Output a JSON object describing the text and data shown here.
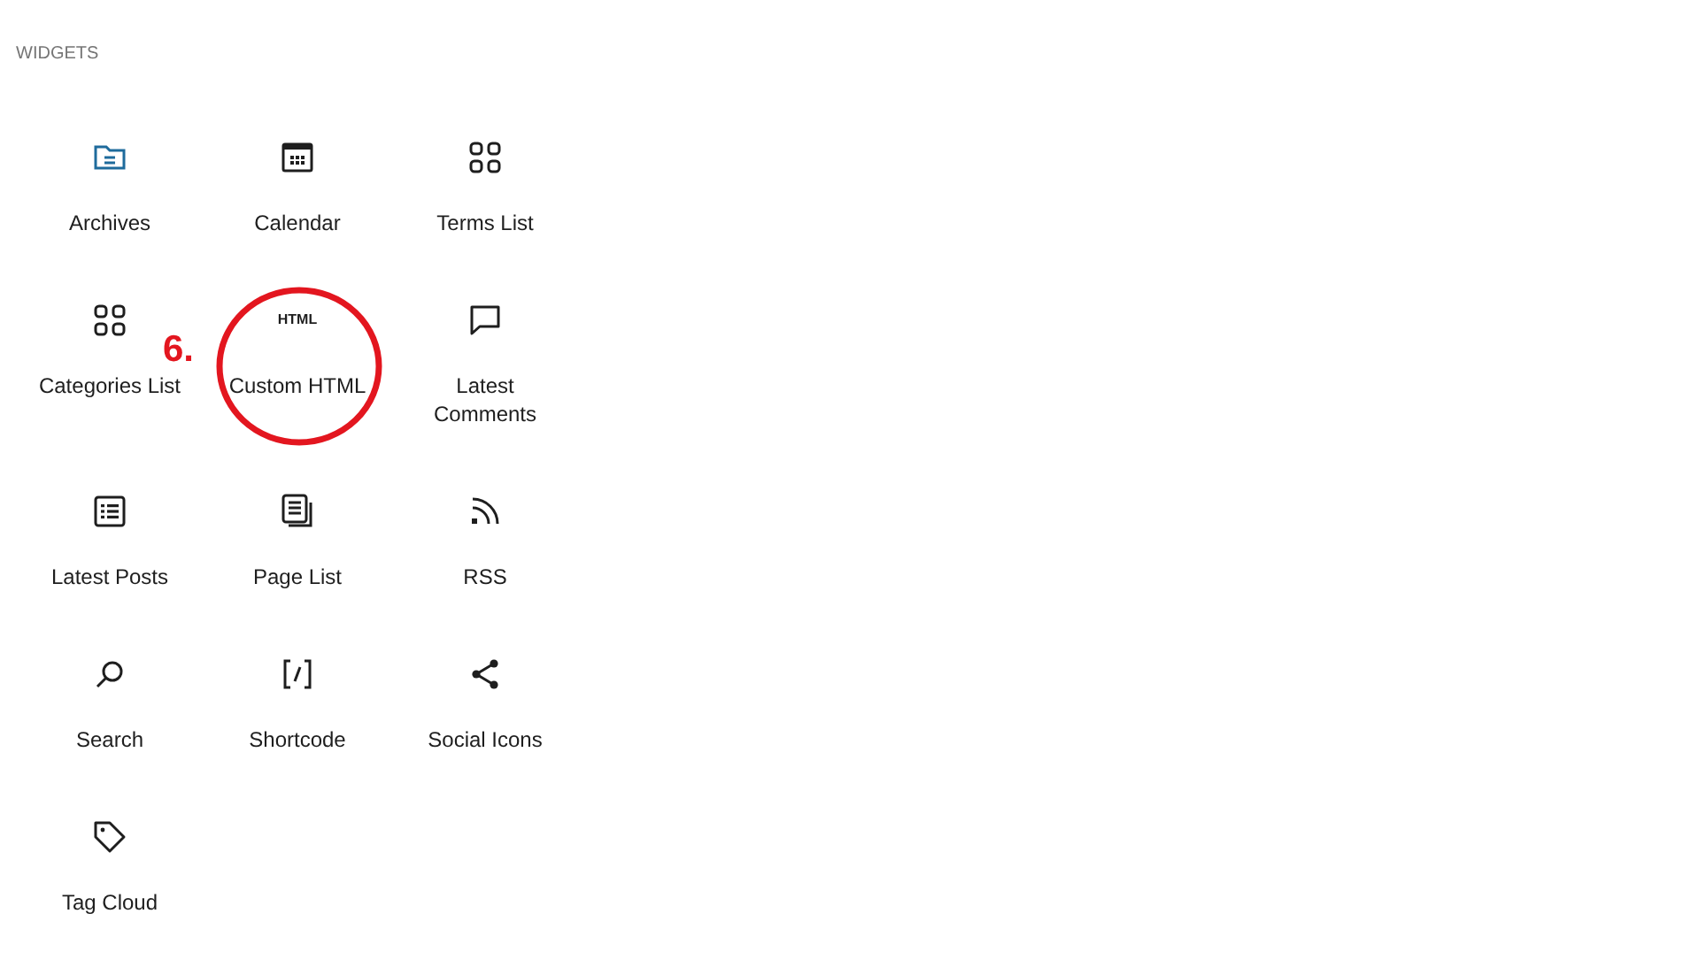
{
  "panel": {
    "heading": "WIDGETS"
  },
  "blocks": [
    {
      "label": "Archives",
      "kind": "archive",
      "highlighted": true,
      "circled": false
    },
    {
      "label": "Calendar",
      "kind": "calendar",
      "highlighted": false,
      "circled": false
    },
    {
      "label": "Terms List",
      "kind": "grid",
      "highlighted": false,
      "circled": false
    },
    {
      "label": "Categories List",
      "kind": "grid",
      "highlighted": false,
      "circled": false
    },
    {
      "label": "Custom HTML",
      "kind": "text",
      "icon_text": "HTML",
      "highlighted": false,
      "circled": true,
      "note": "6."
    },
    {
      "label": "Latest Comments",
      "kind": "comment",
      "highlighted": false,
      "circled": false
    },
    {
      "label": "Latest Posts",
      "kind": "list",
      "highlighted": false,
      "circled": false
    },
    {
      "label": "Page List",
      "kind": "pages",
      "highlighted": false,
      "circled": false
    },
    {
      "label": "RSS",
      "kind": "rss",
      "highlighted": false,
      "circled": false
    },
    {
      "label": "Search",
      "kind": "search",
      "highlighted": false,
      "circled": false
    },
    {
      "label": "Shortcode",
      "kind": "shortcode",
      "highlighted": false,
      "circled": false
    },
    {
      "label": "Social Icons",
      "kind": "share",
      "highlighted": false,
      "circled": false
    },
    {
      "label": "Tag Cloud",
      "kind": "tag",
      "highlighted": false,
      "circled": false
    }
  ]
}
